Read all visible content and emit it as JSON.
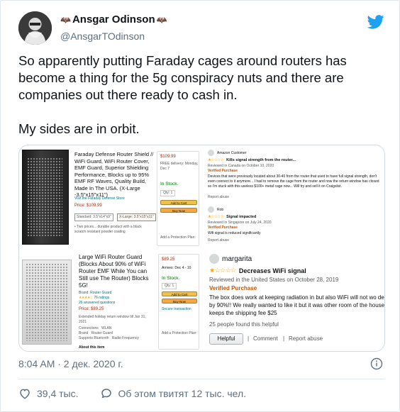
{
  "author": {
    "display_name": "Ansgar Odinson",
    "handle": "@AnsgarTOdinson",
    "name_emoji_left": "🦇",
    "name_emoji_right": "🦇"
  },
  "tweet": {
    "paragraph_1": "So apparently putting Faraday cages around routers has become a thing for the 5g conspiracy nuts and there are companies out there ready to cash in.",
    "paragraph_2": "My sides are in orbit.",
    "timestamp": "8:04 AM · 2 дек. 2020 г."
  },
  "actions": {
    "likes": "39,4 тыс.",
    "retweets_text": "Об этом твитят 12 тыс. чел."
  },
  "media": {
    "product_1": {
      "title": "Faraday Defense Router Shield // WiFi Guard, WiFi Router Cover, EMF Guard, Superior Shielding Performance, Blocks up to 95% EMF RF Waves, Quality Build, Made In The USA. (X-Large -3.5\"x15\"x11\")",
      "brand": "Visit the Faraday Defense Store",
      "price": "Price: $109.99",
      "size_standard": "Standard: 3.5\"x14\"x9\"",
      "size_xlarge": "X-Large: 3.5\"x15\"x11\"",
      "buy_price": "$109.99",
      "in_stock": "In Stock.",
      "qty": "Qty: 1",
      "add_to_cart": "Add to Cart",
      "buy_now": "Buy Now",
      "protection": "Add a Protection Plan:"
    },
    "review_1": {
      "name": "Amazon Customer",
      "title": "Kills signal strength from the router...",
      "date": "Reviewed in Canada on October 10, 2020",
      "verified": "Verified Purchase",
      "body": "Devices that were previously located about 30-40 from the router that used to have full signal strength, don't even connect to it anymore... I had to remove the cage from the router and now the return window has closed so I'm stuck with this useless $100+ metal cage now... Will try and sell it on Craigslist.",
      "report": "Report abuse"
    },
    "review_2": {
      "name": "Rob",
      "title": "Signal impacted",
      "date": "Reviewed in Singapore on July 24, 2020",
      "verified": "Verified Purchase",
      "body": "Wifi signal is reduced significantly",
      "report": "Report abuse"
    },
    "product_2": {
      "title": "Large WiFi Router Guard (Blocks About 90% of WiFi Router EMF While You can Still use The Router) Blocks 5G!",
      "brand": "Brand: Router Guard",
      "ratings": "76 ratings",
      "answered": "26 answered questions",
      "price": "Price: $89.25",
      "buy_price": "$89.25",
      "arrives": "Arrives: Dec 4 - 10",
      "in_stock": "In Stock.",
      "qty": "Qty: 1",
      "add_to_cart": "Add to Cart",
      "buy_now": "Buy Now",
      "secure": "Secure transaction",
      "protection": "Add a Protection Plan:",
      "about": "About this item",
      "spec_connections": "Connections",
      "spec_connections_val": "WLAN",
      "spec_brand": "Brand",
      "spec_brand_val": "Router Guard",
      "spec_supports": "Supports Bluetooth",
      "spec_supports_val": "Radio Frequency"
    },
    "review_3": {
      "name": "margarita",
      "title": "Decreases WiFi signal",
      "date": "Reviewed in the United States on October 28, 2019",
      "verified": "Verified Purchase",
      "body": "The box does work at keeping radiation in but also WiFi will not wo decreases the signal by 90%!! We really wanted to like it but it was other room of the house. Also the seller keeps the shipping fee $25",
      "helpful_count": "25 people found this helpful",
      "helpful": "Helpful",
      "comment": "Comment",
      "report": "Report abuse"
    }
  },
  "colors": {
    "twitter_blue": "#1da1f2",
    "amazon_star": "#ffa41c",
    "amazon_verified": "#c45500",
    "text_secondary": "#5b7083"
  },
  "icons": [
    "twitter-bird-icon",
    "info-icon",
    "heart-icon",
    "comment-icon",
    "bat-emoji-icon"
  ]
}
